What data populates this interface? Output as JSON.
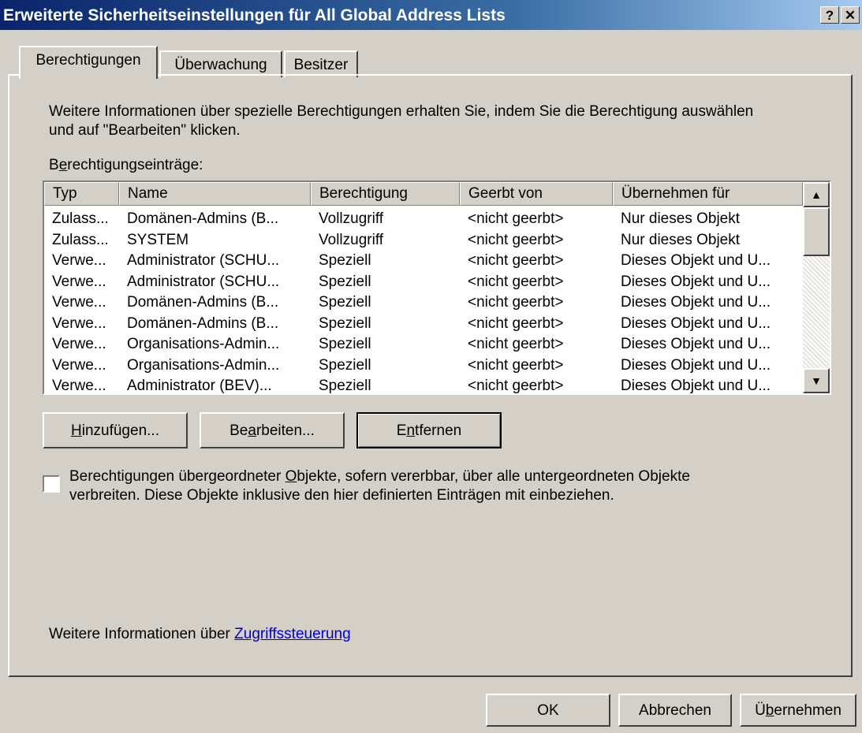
{
  "window": {
    "title": "Erweiterte Sicherheitseinstellungen für All Global Address Lists",
    "help_label": "?",
    "close_label": "✕"
  },
  "tabs": [
    {
      "label": "Berechtigungen",
      "active": true
    },
    {
      "label": "Überwachung",
      "active": false
    },
    {
      "label": "Besitzer",
      "active": false
    }
  ],
  "info_text_line1": "Weitere Informationen über spezielle Berechtigungen erhalten Sie, indem Sie die Berechtigung auswählen",
  "info_text_line2": "und auf \"Bearbeiten\" klicken.",
  "entries_label_pre": "B",
  "entries_label_acc": "e",
  "entries_label_post": "rechtigungseinträge:",
  "list": {
    "columns": [
      "Typ",
      "Name",
      "Berechtigung",
      "Geerbt von",
      "Übernehmen für"
    ],
    "rows": [
      [
        "Zulass...",
        "Domänen-Admins (B...",
        "Vollzugriff",
        "<nicht geerbt>",
        "Nur dieses Objekt"
      ],
      [
        "Zulass...",
        "SYSTEM",
        "Vollzugriff",
        "<nicht geerbt>",
        "Nur dieses Objekt"
      ],
      [
        "Verwe...",
        "Administrator (SCHU...",
        "Speziell",
        "<nicht geerbt>",
        "Dieses Objekt und U..."
      ],
      [
        "Verwe...",
        "Administrator (SCHU...",
        "Speziell",
        "<nicht geerbt>",
        "Dieses Objekt und U..."
      ],
      [
        "Verwe...",
        "Domänen-Admins (B...",
        "Speziell",
        "<nicht geerbt>",
        "Dieses Objekt und U..."
      ],
      [
        "Verwe...",
        "Domänen-Admins (B...",
        "Speziell",
        "<nicht geerbt>",
        "Dieses Objekt und U..."
      ],
      [
        "Verwe...",
        "Organisations-Admin...",
        "Speziell",
        "<nicht geerbt>",
        "Dieses Objekt und U..."
      ],
      [
        "Verwe...",
        "Organisations-Admin...",
        "Speziell",
        "<nicht geerbt>",
        "Dieses Objekt und U..."
      ],
      [
        "Verwe...",
        "Administrator (BEV)...",
        "Speziell",
        "<nicht geerbt>",
        "Dieses Objekt und U..."
      ]
    ]
  },
  "buttons": {
    "add": {
      "acc": "H",
      "rest": "inzufügen..."
    },
    "edit": {
      "pre": "Be",
      "acc": "a",
      "post": "rbeiten..."
    },
    "remove": {
      "pre": "E",
      "acc": "n",
      "post": "tfernen"
    }
  },
  "inherit": {
    "line1_pre": "Berechtigungen übergeordneter ",
    "line1_acc": "O",
    "line1_post": "bjekte, sofern vererbbar, über alle untergeordneten Objekte",
    "line2": "verbreiten. Diese Objekte inklusive den hier definierten Einträgen mit einbeziehen.",
    "checked": false
  },
  "footer": {
    "more_info": "Weitere Informationen über",
    "link": "Zugriffssteuerung"
  },
  "dialog_buttons": {
    "ok": "OK",
    "cancel": "Abbrechen",
    "apply_pre": "Ü",
    "apply_acc": "b",
    "apply_post": "ernehmen"
  }
}
